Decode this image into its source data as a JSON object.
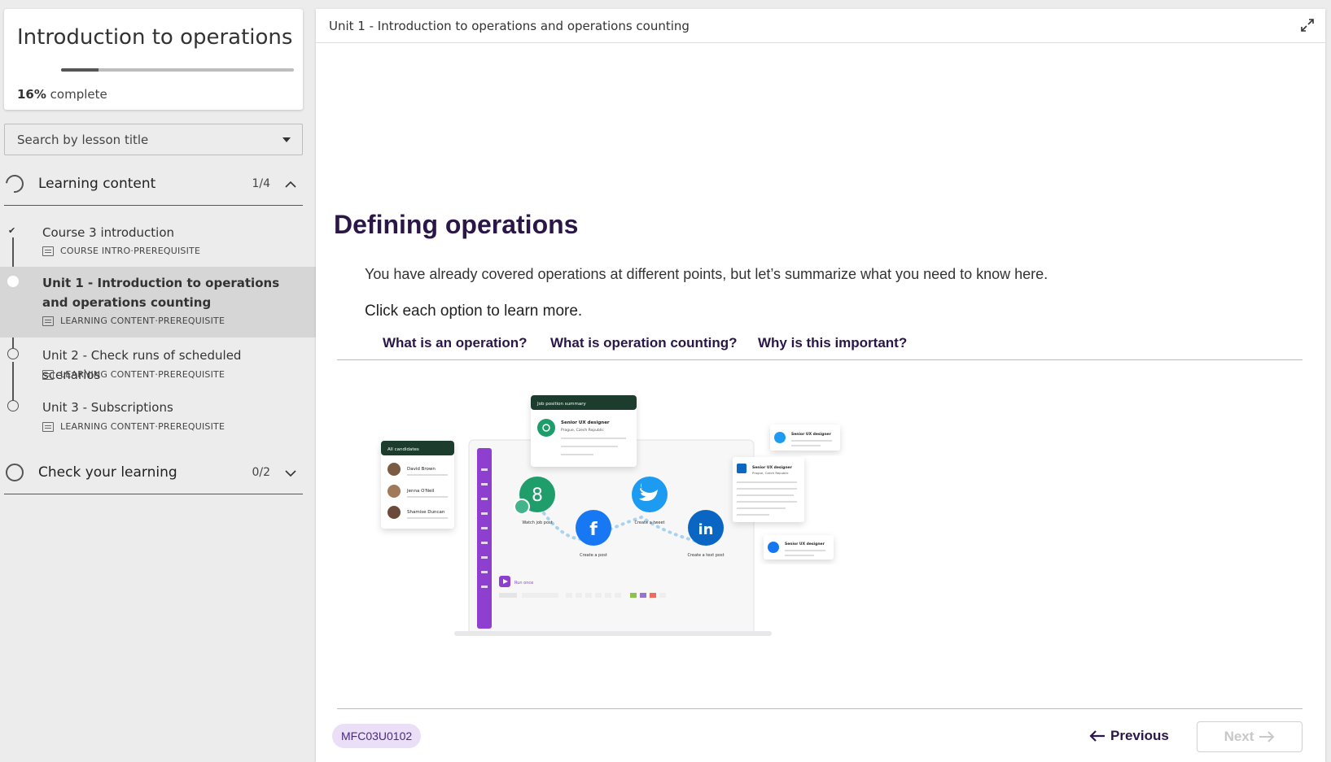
{
  "sidebar": {
    "course_title": "Introduction to operations",
    "progress_percent": "16%",
    "progress_suffix": " complete",
    "progress_fraction": 0.16,
    "search_placeholder": "Search by lesson title",
    "sections": [
      {
        "label": "Learning content",
        "count": "1/4",
        "expanded": true,
        "lessons": [
          {
            "title": "Course 3 introduction",
            "type": "COURSE INTRO",
            "tag": "PREREQUISITE",
            "completed": true,
            "active": false
          },
          {
            "title": "Unit 1 - Introduction to operations and operations counting",
            "type": "LEARNING CONTENT",
            "tag": "PREREQUISITE",
            "completed": false,
            "active": true
          },
          {
            "title": "Unit 2 - Check runs of scheduled scenarios",
            "type": "LEARNING CONTENT",
            "tag": "PREREQUISITE",
            "completed": false,
            "active": false
          },
          {
            "title": "Unit 3 - Subscriptions",
            "type": "LEARNING CONTENT",
            "tag": "PREREQUISITE",
            "completed": false,
            "active": false
          }
        ]
      },
      {
        "label": "Check your learning",
        "count": "0/2",
        "expanded": false
      }
    ],
    "meta_separator": " · "
  },
  "main": {
    "breadcrumb": "Unit 1 - Introduction to operations and operations counting",
    "title": "Defining operations",
    "intro": "You have already covered operations at different points, but let’s summarize what you need to know here.",
    "cta": "Click each option to learn more.",
    "tabs": [
      "What is an operation?",
      "What is operation counting?",
      "Why is this important?"
    ],
    "illustration": {
      "job_card_header": "Job position summary",
      "job_title": "Senior UX designer",
      "job_location": "Prague, Czech Republic",
      "candidates_header": "All candidates",
      "candidates": [
        "David Brown",
        "Jenna O'Neil",
        "Shamise Duncan"
      ],
      "modules": [
        "Watch job post",
        "Create a post",
        "Create a tweet",
        "Create a text post"
      ],
      "run_label": "Run once",
      "social_cards": [
        "Senior UX designer",
        "Senior UX designer",
        "Senior UX designer"
      ],
      "social_location": "Prague, Czech Republic"
    },
    "lesson_code": "MFC03U0102",
    "prev_label": "Previous",
    "next_label": "Next"
  },
  "colors": {
    "heading": "#2a1747",
    "badge_bg": "#eadff7",
    "badge_text": "#4a2a79",
    "make_purple": "#6d2bb8",
    "green": "#1f9d6a",
    "twitter": "#1d9bf0",
    "facebook": "#1877f2",
    "linkedin": "#0a66c2"
  }
}
